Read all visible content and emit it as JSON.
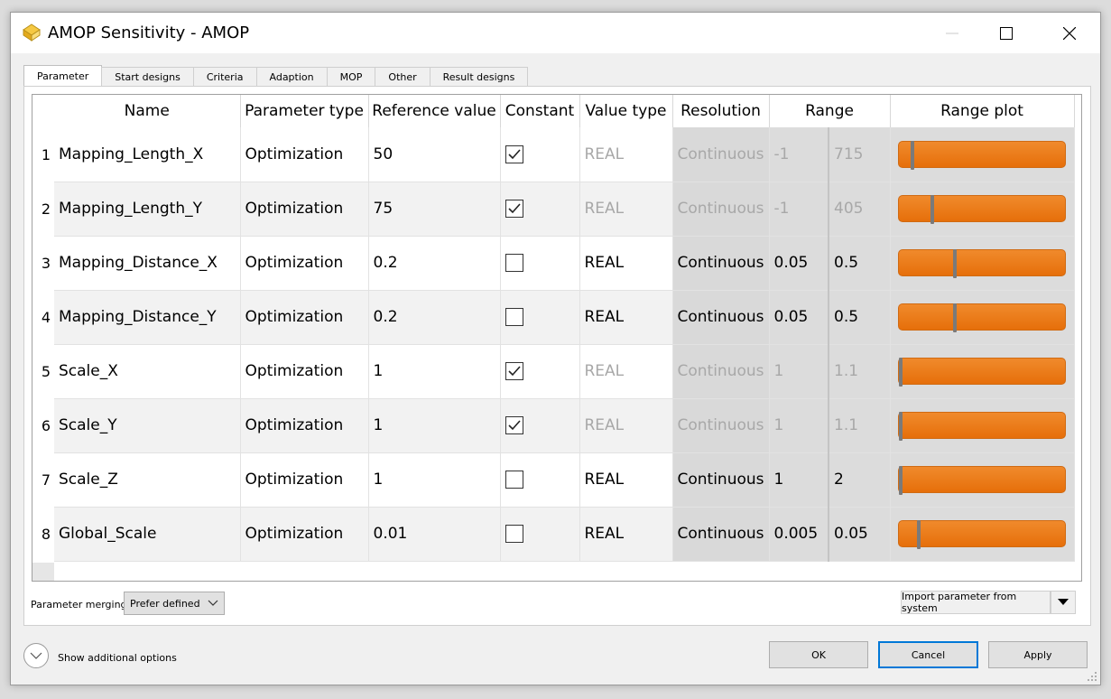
{
  "window": {
    "title": "AMOP Sensitivity - AMOP"
  },
  "tabs": [
    "Parameter",
    "Start designs",
    "Criteria",
    "Adaption",
    "MOP",
    "Other",
    "Result designs"
  ],
  "table": {
    "columns": [
      "Name",
      "Parameter type",
      "Reference value",
      "Constant",
      "Value type",
      "Resolution",
      "Range",
      "Range plot"
    ],
    "rows": [
      {
        "num": "1",
        "name": "Mapping_Length_X",
        "ptype": "Optimization",
        "ref": "50",
        "constant": true,
        "vtype": "REAL",
        "res": "Continuous",
        "min": "-1",
        "max": "715",
        "plot_pos": 0.07
      },
      {
        "num": "2",
        "name": "Mapping_Length_Y",
        "ptype": "Optimization",
        "ref": "75",
        "constant": true,
        "vtype": "REAL",
        "res": "Continuous",
        "min": "-1",
        "max": "405",
        "plot_pos": 0.19
      },
      {
        "num": "3",
        "name": "Mapping_Distance_X",
        "ptype": "Optimization",
        "ref": "0.2",
        "constant": false,
        "vtype": "REAL",
        "res": "Continuous",
        "min": "0.05",
        "max": "0.5",
        "plot_pos": 0.33
      },
      {
        "num": "4",
        "name": "Mapping_Distance_Y",
        "ptype": "Optimization",
        "ref": "0.2",
        "constant": false,
        "vtype": "REAL",
        "res": "Continuous",
        "min": "0.05",
        "max": "0.5",
        "plot_pos": 0.33
      },
      {
        "num": "5",
        "name": "Scale_X",
        "ptype": "Optimization",
        "ref": "1",
        "constant": true,
        "vtype": "REAL",
        "res": "Continuous",
        "min": "1",
        "max": "1.1",
        "plot_pos": 0.0
      },
      {
        "num": "6",
        "name": "Scale_Y",
        "ptype": "Optimization",
        "ref": "1",
        "constant": true,
        "vtype": "REAL",
        "res": "Continuous",
        "min": "1",
        "max": "1.1",
        "plot_pos": 0.0
      },
      {
        "num": "7",
        "name": "Scale_Z",
        "ptype": "Optimization",
        "ref": "1",
        "constant": false,
        "vtype": "REAL",
        "res": "Continuous",
        "min": "1",
        "max": "2",
        "plot_pos": 0.0
      },
      {
        "num": "8",
        "name": "Global_Scale",
        "ptype": "Optimization",
        "ref": "0.01",
        "constant": false,
        "vtype": "REAL",
        "res": "Continuous",
        "min": "0.005",
        "max": "0.05",
        "plot_pos": 0.11
      }
    ]
  },
  "merging": {
    "label": "Parameter merging:",
    "value": "Prefer defined"
  },
  "import_button": "Import parameter from system",
  "options_label": "Show additional options",
  "buttons": {
    "ok": "OK",
    "cancel": "Cancel",
    "apply": "Apply"
  }
}
